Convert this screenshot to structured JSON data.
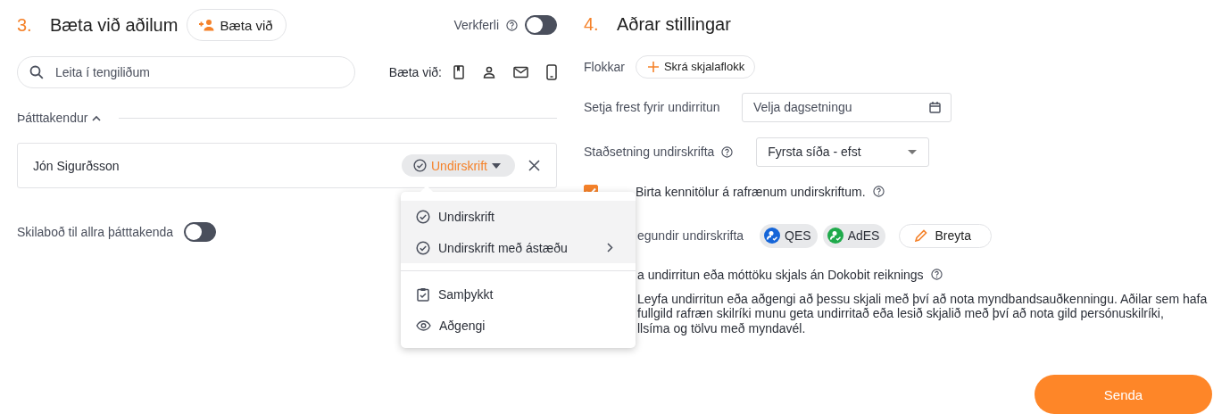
{
  "participants_section": {
    "number": "3.",
    "title": "Bæta við aðilum",
    "add_button": "Bæta við",
    "workflow": {
      "label": "Verkferli",
      "on": false
    },
    "search": {
      "placeholder": "Leita í tengiliðum"
    },
    "add_via_label": "Bæta við:",
    "participants_header": {
      "label": "Þátttakendur",
      "expanded": true
    },
    "participants": [
      {
        "name": "Jón Sigurðsson",
        "role": "Undirskrift"
      }
    ],
    "message_all": {
      "label": "Skilaboð til allra þátttakenda",
      "on": false
    }
  },
  "role_menu": {
    "groups": [
      [
        {
          "label": "Undirskrift",
          "kind": "signature",
          "highlighted": true,
          "submenu": false
        },
        {
          "label": "Undirskrift með ástæðu",
          "kind": "signature",
          "highlighted": true,
          "submenu": true
        }
      ],
      [
        {
          "label": "Samþykkt",
          "kind": "approval",
          "highlighted": false,
          "submenu": false
        },
        {
          "label": "Aðgengi",
          "kind": "access",
          "highlighted": false,
          "submenu": false
        }
      ]
    ]
  },
  "settings_section": {
    "number": "4.",
    "title": "Aðrar stillingar",
    "categories_label": "Flokkar",
    "categories_button": "Skrá skjalaflokk",
    "deadline": {
      "label": "Setja frest fyrir undirritun",
      "placeholder": "Velja dagsetningu"
    },
    "position": {
      "label": "Staðsetning undirskrifta",
      "value": "Fyrsta síða - efst"
    },
    "show_id": {
      "label": "Birta kennitölur á rafrænum undirskriftum.",
      "checked": true
    },
    "signature_types": {
      "label": "egundir undirskrifta",
      "types": [
        {
          "label": "QES",
          "color": "#1565d8"
        },
        {
          "label": "AdES",
          "color": "#1faa4b"
        }
      ],
      "edit_button": "Breyta"
    },
    "no_account": {
      "label": "a undirritun eða móttöku skjals án Dokobit reiknings"
    },
    "description_lines": [
      "Leyfa undirritun eða aðgengi að þessu skjali með því að nota myndbandsauðkenningu. Aðilar sem hafa",
      "fullgild rafræn skilríki munu geta undirritað eða lesið skjalið með því að nota gild persónuskilríki,",
      "llsíma og tölvu með myndavél."
    ],
    "send_button": "Senda"
  }
}
